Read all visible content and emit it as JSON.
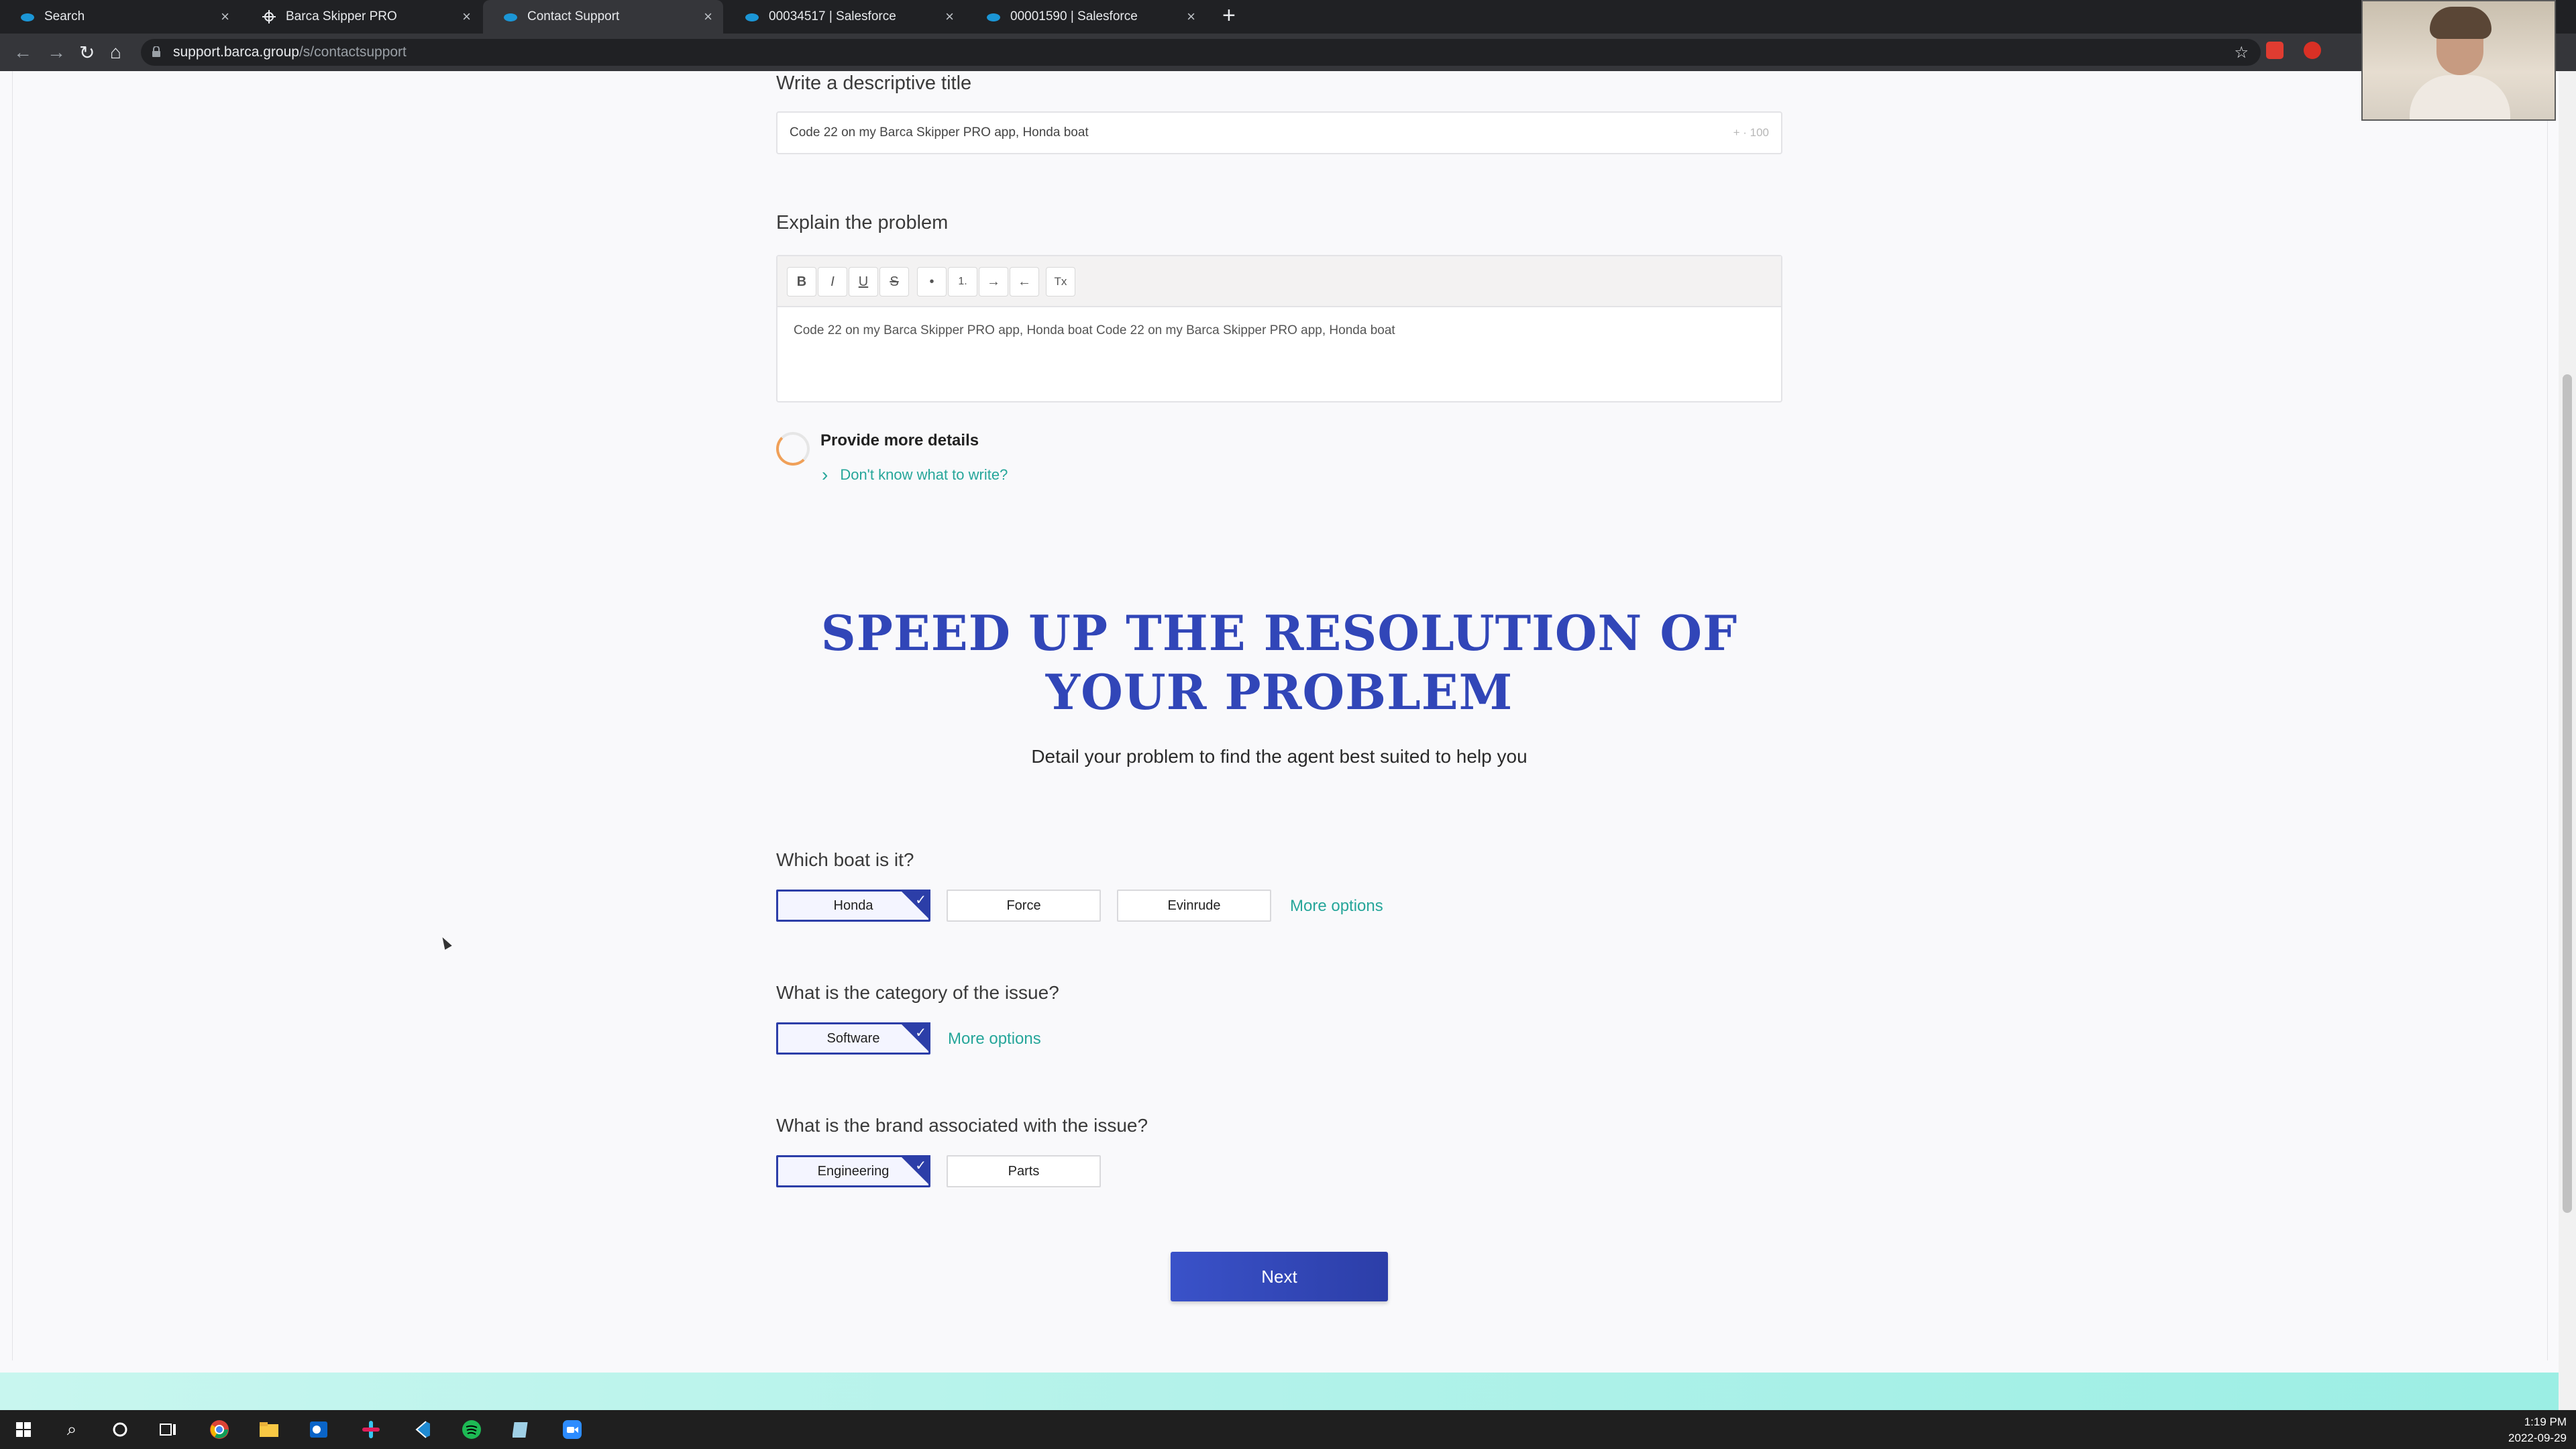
{
  "browser": {
    "tabs": [
      {
        "label": "Search",
        "icon": "salesforce-cloud-icon"
      },
      {
        "label": "Barca Skipper PRO",
        "icon": "helm-icon"
      },
      {
        "label": "Contact Support",
        "icon": "salesforce-cloud-icon",
        "active": true
      },
      {
        "label": "00034517 | Salesforce",
        "icon": "salesforce-cloud-icon"
      },
      {
        "label": "00001590 | Salesforce",
        "icon": "salesforce-cloud-icon"
      }
    ],
    "url_host": "support.barca.group",
    "url_path": "/s/contactsupport"
  },
  "form": {
    "title_label": "Write a descriptive title",
    "title_value": "Code 22 on my Barca Skipper PRO app, Honda boat",
    "title_count": "+ · 100",
    "problem_label": "Explain the problem",
    "toolbar": [
      "B",
      "I",
      "U",
      "S",
      "•",
      "1.",
      "→",
      "←",
      "Tx"
    ],
    "problem_value": "Code 22 on my Barca Skipper PRO app, Honda boat Code 22 on my Barca Skipper PRO app, Honda boat",
    "more_details": "Provide more details",
    "dont_know": "Don't know what to write?"
  },
  "hero": {
    "title": "SPEED UP THE RESOLUTION OF YOUR PROBLEM",
    "subtitle": "Detail your problem to find the agent best suited to help you"
  },
  "questions": {
    "boat": {
      "label": "Which boat is it?",
      "options": [
        "Honda",
        "Force",
        "Evinrude"
      ],
      "selected": "Honda",
      "more": "More options"
    },
    "category": {
      "label": "What is the category of the issue?",
      "options": [
        "Software"
      ],
      "selected": "Software",
      "more": "More options"
    },
    "brand": {
      "label": "What is the brand associated with the issue?",
      "options": [
        "Engineering",
        "Parts"
      ],
      "selected": "Engineering"
    }
  },
  "next_label": "Next",
  "colors": {
    "accent": "#2c3ea8",
    "link": "#26a69a",
    "hero": "#3146b8"
  },
  "taskbar": {
    "time": "1:19 PM",
    "date": "2022-09-29"
  }
}
